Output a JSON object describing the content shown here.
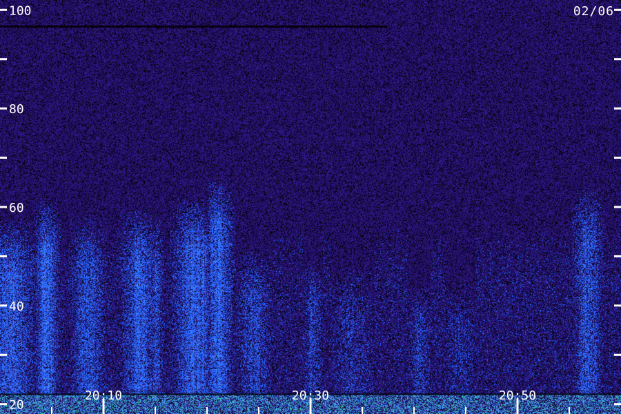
{
  "date_label": "02/06",
  "colors": {
    "background": "#1a0a4a",
    "noise_low": "#150745",
    "noise_high": "#3a1fa0",
    "activity": "#1e5cff",
    "activity_bright": "#5aa0ff",
    "hot": "#40e0a0",
    "tick": "#ffffff"
  },
  "chart_data": {
    "type": "heatmap",
    "title": "",
    "xlabel": "",
    "ylabel": "",
    "y_ticks": [
      {
        "value": 20,
        "label": "20"
      },
      {
        "value": 30,
        "label": ""
      },
      {
        "value": 40,
        "label": "40"
      },
      {
        "value": 50,
        "label": ""
      },
      {
        "value": 60,
        "label": "60"
      },
      {
        "value": 70,
        "label": ""
      },
      {
        "value": 80,
        "label": "80"
      },
      {
        "value": 90,
        "label": ""
      },
      {
        "value": 100,
        "label": "100"
      }
    ],
    "x_ticks": [
      {
        "minute": 10,
        "label": "20:10"
      },
      {
        "minute": 30,
        "label": "20:30"
      },
      {
        "minute": 50,
        "label": "20:50"
      }
    ],
    "x_minor_step_min": 5,
    "x_range_min": [
      0,
      60
    ],
    "ylim": [
      18,
      102
    ],
    "activity_ceiling": 60,
    "high_band": [
      18,
      22
    ],
    "bursts": [
      {
        "minute": 1.0,
        "width": 2.0,
        "strength": 0.8,
        "top": 58
      },
      {
        "minute": 4.5,
        "width": 1.0,
        "strength": 0.9,
        "top": 62
      },
      {
        "minute": 8.5,
        "width": 1.5,
        "strength": 0.65,
        "top": 58
      },
      {
        "minute": 13.5,
        "width": 1.5,
        "strength": 0.8,
        "top": 60
      },
      {
        "minute": 15.0,
        "width": 0.7,
        "strength": 0.55,
        "top": 58
      },
      {
        "minute": 18.8,
        "width": 1.8,
        "strength": 0.85,
        "top": 62
      },
      {
        "minute": 21.0,
        "width": 1.2,
        "strength": 0.9,
        "top": 66
      },
      {
        "minute": 24.5,
        "width": 1.5,
        "strength": 0.55,
        "top": 52
      },
      {
        "minute": 30.2,
        "width": 0.8,
        "strength": 0.5,
        "top": 50
      },
      {
        "minute": 34.0,
        "width": 2.0,
        "strength": 0.35,
        "top": 48
      },
      {
        "minute": 40.5,
        "width": 1.0,
        "strength": 0.45,
        "top": 45
      },
      {
        "minute": 44.5,
        "width": 1.5,
        "strength": 0.3,
        "top": 45
      },
      {
        "minute": 56.8,
        "width": 1.2,
        "strength": 0.7,
        "top": 64
      }
    ]
  }
}
